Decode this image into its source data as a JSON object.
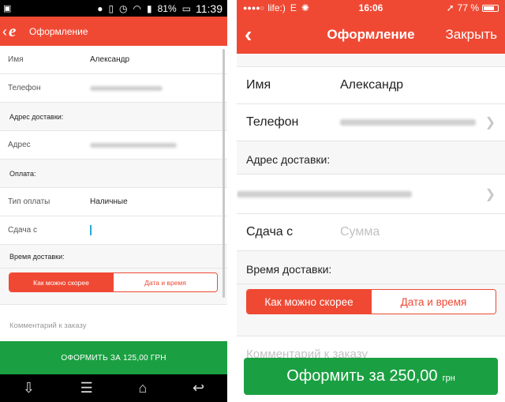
{
  "colors": {
    "accent": "#ef4934",
    "submit": "#1aa042"
  },
  "android": {
    "status": {
      "battery": "81%",
      "time": "11:39"
    },
    "action_bar": {
      "logo": "e",
      "title": "Оформление"
    },
    "name": {
      "label": "Имя",
      "value": "Александр"
    },
    "phone": {
      "label": "Телефон"
    },
    "delivery_address_header": "Адрес доставки:",
    "address": {
      "label": "Адрес"
    },
    "payment_header": "Оплата:",
    "payment_type": {
      "label": "Тип оплаты",
      "value": "Наличные"
    },
    "change": {
      "label": "Сдача с"
    },
    "delivery_time_header": "Время доставки:",
    "segment": {
      "asap": "Как можно скорее",
      "datetime": "Дата и время"
    },
    "comment_placeholder": "Комментарий к заказу",
    "submit_label": "ОФОРМИТЬ ЗА 125,00 ГРН"
  },
  "ios": {
    "status": {
      "carrier": "life:)",
      "network": "E",
      "time": "16:06",
      "battery": "77 %"
    },
    "nav": {
      "title": "Оформление",
      "close": "Закрыть"
    },
    "name": {
      "label": "Имя",
      "value": "Александр"
    },
    "phone": {
      "label": "Телефон"
    },
    "delivery_address_header": "Адрес доставки:",
    "change": {
      "label": "Сдача с",
      "placeholder": "Сумма"
    },
    "delivery_time_header": "Время доставки:",
    "segment": {
      "asap": "Как можно скорее",
      "datetime": "Дата и время"
    },
    "comment_placeholder": "Комментарий к заказу",
    "submit": {
      "label": "Оформить за 250,00",
      "currency": "грн"
    }
  }
}
